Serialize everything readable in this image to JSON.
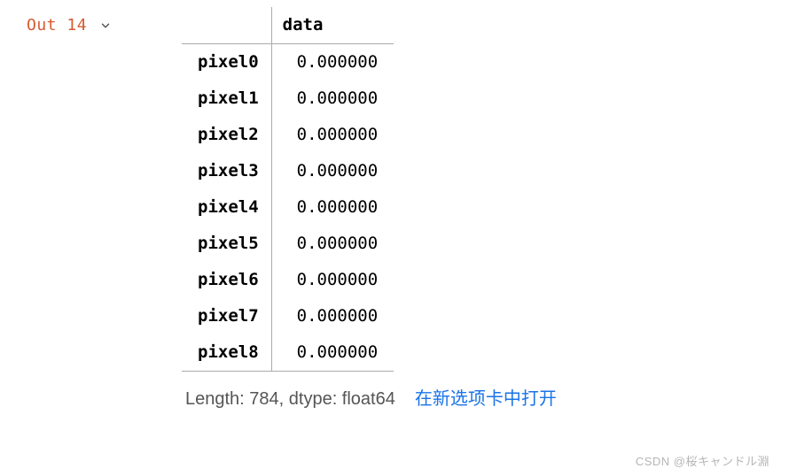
{
  "gutter": {
    "out_word": "Out",
    "out_num": "14"
  },
  "table": {
    "column_header": "data",
    "rows": [
      {
        "index": "pixel0",
        "value": "0.000000"
      },
      {
        "index": "pixel1",
        "value": "0.000000"
      },
      {
        "index": "pixel2",
        "value": "0.000000"
      },
      {
        "index": "pixel3",
        "value": "0.000000"
      },
      {
        "index": "pixel4",
        "value": "0.000000"
      },
      {
        "index": "pixel5",
        "value": "0.000000"
      },
      {
        "index": "pixel6",
        "value": "0.000000"
      },
      {
        "index": "pixel7",
        "value": "0.000000"
      },
      {
        "index": "pixel8",
        "value": "0.000000"
      }
    ]
  },
  "footer": {
    "summary": "Length: 784, dtype: float64",
    "open_link": "在新选项卡中打开"
  },
  "watermark": "CSDN @桜キャンドル淵"
}
